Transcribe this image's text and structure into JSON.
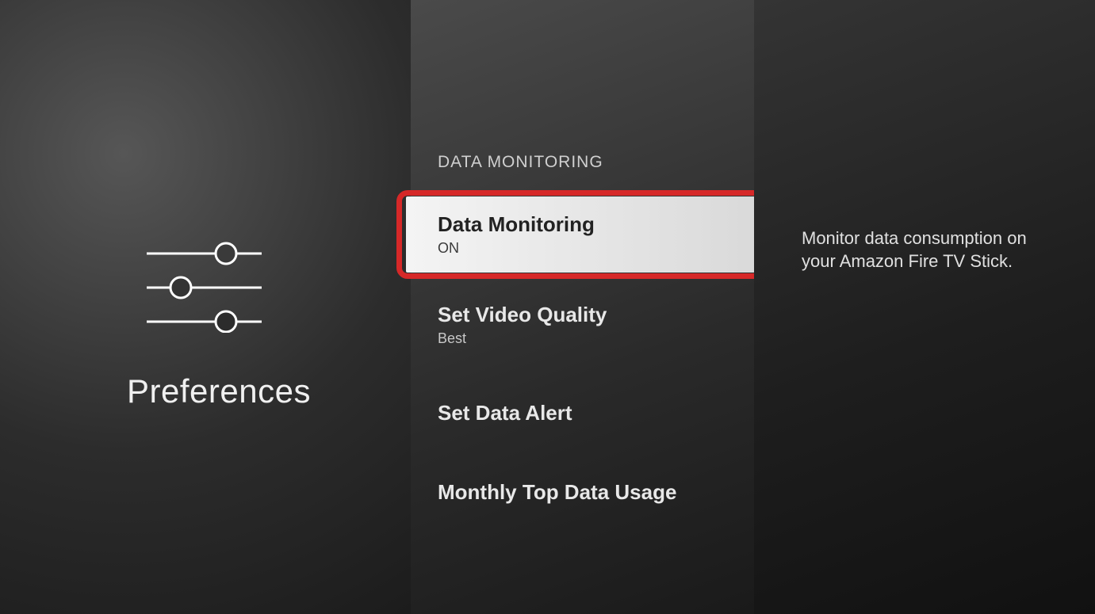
{
  "left": {
    "title": "Preferences"
  },
  "section_header": "DATA MONITORING",
  "menu": {
    "data_monitoring": {
      "label": "Data Monitoring",
      "value": "ON"
    },
    "set_video_quality": {
      "label": "Set Video Quality",
      "value": "Best"
    },
    "set_data_alert": {
      "label": "Set Data Alert"
    },
    "monthly_top": {
      "label": "Monthly Top Data Usage"
    }
  },
  "description": "Monitor data consumption on your Amazon Fire TV Stick."
}
